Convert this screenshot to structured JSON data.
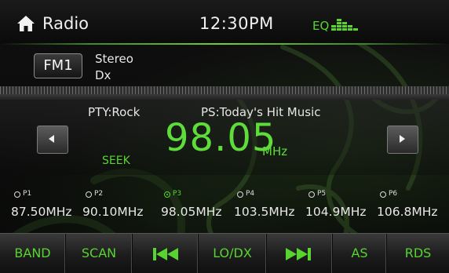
{
  "header": {
    "title": "Radio",
    "time": "12:30PM",
    "eq_label": "EQ",
    "home_icon": "home-icon",
    "eq_icon": "equalizer-bars-icon"
  },
  "band": {
    "name": "FM1",
    "stereo": "Stereo",
    "dx": "Dx"
  },
  "tuner": {
    "pty": "PTY:Rock",
    "ps": "PS:Today's Hit Music",
    "seek": "SEEK",
    "frequency": "98.05",
    "unit": "MHz"
  },
  "presets": [
    {
      "label": "P1",
      "freq": "87.50MHz",
      "active": false
    },
    {
      "label": "P2",
      "freq": "90.10MHz",
      "active": false
    },
    {
      "label": "P3",
      "freq": "98.05MHz",
      "active": true
    },
    {
      "label": "P4",
      "freq": "103.5MHz",
      "active": false
    },
    {
      "label": "P5",
      "freq": "104.9MHz",
      "active": false
    },
    {
      "label": "P6",
      "freq": "106.8MHz",
      "active": false
    }
  ],
  "bottom_bar": {
    "band": "BAND",
    "scan": "SCAN",
    "lodx": "LO/DX",
    "as": "AS",
    "rds": "RDS"
  },
  "colors": {
    "accent_green": "#58d431",
    "frequency_green": "#5ddc3a"
  }
}
